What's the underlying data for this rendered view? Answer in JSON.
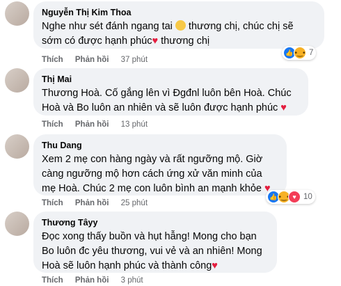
{
  "comments": [
    {
      "author": "Nguyễn Thị Kim Thoa",
      "text_1": "Nghe như sét đánh ngang tai ",
      "text_2": " thương chị, chúc chị sẽ sớm có được hạnh phúc",
      "text_3": " thương chị",
      "like_label": "Thích",
      "reply_label": "Phản hồi",
      "time": "37 phút",
      "reaction_count": "7"
    },
    {
      "author": "Thị Mai",
      "text": "Thương Hoà. Cố gắng lên vì Đgđnl luôn bên Hoà. Chúc Hoà và Bo luôn an nhiên và sẽ luôn được hạnh phúc ",
      "like_label": "Thích",
      "reply_label": "Phản hồi",
      "time": "13 phút"
    },
    {
      "author": "Thu Dang",
      "text": "Xem 2 mẹ con hàng ngày và rất ngưỡng mộ. Giờ càng ngưỡng mộ hơn cách ứng xử văn minh của mẹ Hoà. Chúc 2 mẹ con luôn bình an mạnh khỏe ",
      "like_label": "Thích",
      "reply_label": "Phản hồi",
      "time": "25 phút",
      "reaction_count": "10"
    },
    {
      "author": "Thương Tâyy",
      "text": "Đọc xong thấy buồn và hụt hẫng! Mong cho bạn Bo luôn đc yêu thương, vui vẻ và an nhiên! Mong Hoà sẽ luôn hạnh phúc và thành công",
      "like_label": "Thích",
      "reply_label": "Phản hồi",
      "time": "3 phút"
    }
  ],
  "colors": {
    "bubble": "#f0f2f5",
    "meta": "#65676b",
    "like": "#1877f2",
    "heart": "#e41e3f"
  },
  "icons": {
    "heart": "♥",
    "sad": "sad-face",
    "like": "thumbs-up"
  }
}
